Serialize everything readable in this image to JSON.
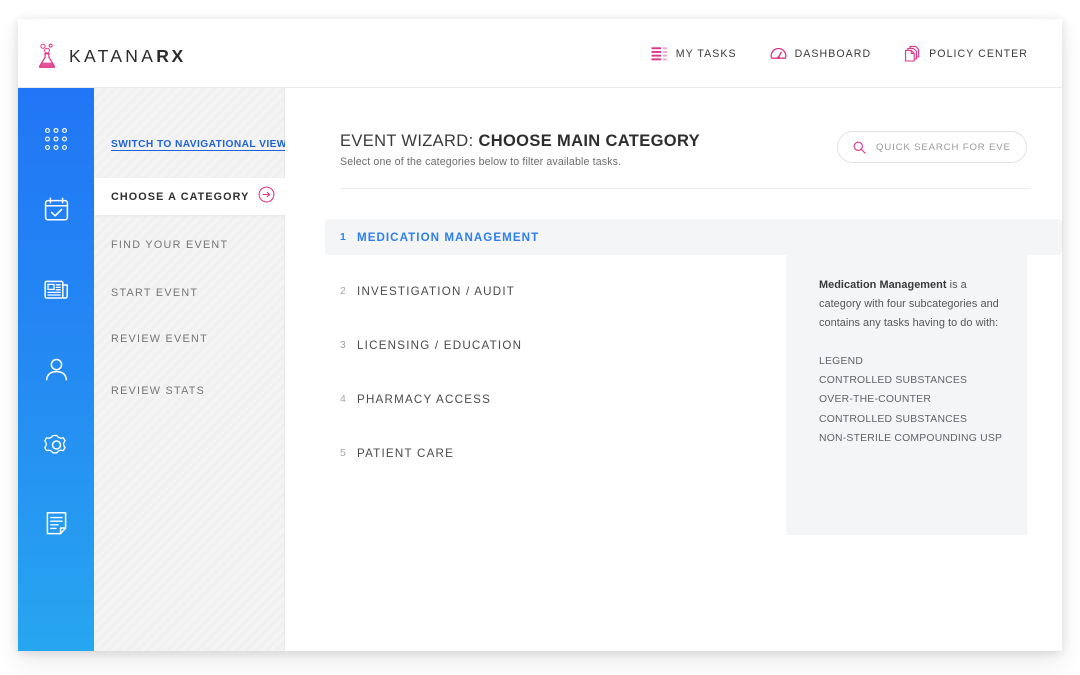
{
  "brand": {
    "name_light": "KATANA",
    "name_bold": "RX",
    "logo_icon": "flask-icon",
    "logo_color": "#e0338a"
  },
  "topnav": {
    "items": [
      {
        "label": "MY TASKS",
        "icon": "list-icon"
      },
      {
        "label": "DASHBOARD",
        "icon": "gauge-icon"
      },
      {
        "label": "POLICY CENTER",
        "icon": "documents-stack-icon"
      }
    ]
  },
  "rail": {
    "items": [
      {
        "icon": "apps-grid-icon"
      },
      {
        "icon": "calendar-check-icon"
      },
      {
        "icon": "newspaper-icon"
      },
      {
        "icon": "user-icon"
      },
      {
        "icon": "gear-icon"
      },
      {
        "icon": "document-edit-icon"
      }
    ]
  },
  "sidebar": {
    "switch_link": "SWITCH TO NAVIGATIONAL VIEW",
    "items": [
      {
        "label": "CHOOSE A CATEGORY",
        "active": true,
        "icon": "arrow-right-circle-icon"
      },
      {
        "label": "FIND YOUR EVENT",
        "active": false
      },
      {
        "label": "START EVENT",
        "active": false
      },
      {
        "label": "REVIEW EVENT",
        "active": false
      },
      {
        "label": "REVIEW STATS",
        "active": false
      }
    ]
  },
  "main": {
    "title_prefix": "EVENT WIZARD: ",
    "title_strong": "CHOOSE MAIN CATEGORY",
    "subtitle": "Select one of the categories below to filter available tasks.",
    "search": {
      "placeholder": "QUICK SEARCH FOR EVENT",
      "value": "",
      "icon": "search-icon"
    },
    "categories": [
      {
        "number": "1",
        "label": "MEDICATION MANAGEMENT",
        "selected": true
      },
      {
        "number": "2",
        "label": "INVESTIGATION / AUDIT",
        "selected": false
      },
      {
        "number": "3",
        "label": "LICENSING / EDUCATION",
        "selected": false
      },
      {
        "number": "4",
        "label": "PHARMACY ACCESS",
        "selected": false
      },
      {
        "number": "5",
        "label": "PATIENT CARE",
        "selected": false
      }
    ],
    "info_panel": {
      "lead_bold": "Medication Management",
      "lead_rest": " is a category with four subcategories and contains any tasks having to do with:",
      "list": [
        "LEGEND",
        "CONTROLLED SUBSTANCES",
        "OVER-THE-COUNTER",
        "CONTROLLED SUBSTANCES",
        "NON-STERILE COMPOUNDING USP"
      ]
    }
  },
  "colors": {
    "accent_pink": "#e0338a",
    "accent_blue": "#2f7ef0",
    "rail_top": "#2176f5",
    "rail_bottom": "#27a6f0",
    "link_blue": "#1e63d6"
  }
}
